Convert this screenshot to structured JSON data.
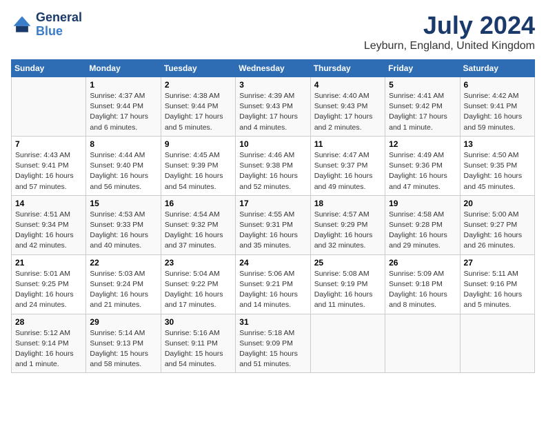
{
  "header": {
    "logo_text_general": "General",
    "logo_text_blue": "Blue",
    "month_title": "July 2024",
    "location": "Leyburn, England, United Kingdom"
  },
  "table": {
    "headers": [
      "Sunday",
      "Monday",
      "Tuesday",
      "Wednesday",
      "Thursday",
      "Friday",
      "Saturday"
    ],
    "rows": [
      [
        {
          "day": "",
          "sunrise": "",
          "sunset": "",
          "daylight": ""
        },
        {
          "day": "1",
          "sunrise": "Sunrise: 4:37 AM",
          "sunset": "Sunset: 9:44 PM",
          "daylight": "Daylight: 17 hours and 6 minutes."
        },
        {
          "day": "2",
          "sunrise": "Sunrise: 4:38 AM",
          "sunset": "Sunset: 9:44 PM",
          "daylight": "Daylight: 17 hours and 5 minutes."
        },
        {
          "day": "3",
          "sunrise": "Sunrise: 4:39 AM",
          "sunset": "Sunset: 9:43 PM",
          "daylight": "Daylight: 17 hours and 4 minutes."
        },
        {
          "day": "4",
          "sunrise": "Sunrise: 4:40 AM",
          "sunset": "Sunset: 9:43 PM",
          "daylight": "Daylight: 17 hours and 2 minutes."
        },
        {
          "day": "5",
          "sunrise": "Sunrise: 4:41 AM",
          "sunset": "Sunset: 9:42 PM",
          "daylight": "Daylight: 17 hours and 1 minute."
        },
        {
          "day": "6",
          "sunrise": "Sunrise: 4:42 AM",
          "sunset": "Sunset: 9:41 PM",
          "daylight": "Daylight: 16 hours and 59 minutes."
        }
      ],
      [
        {
          "day": "7",
          "sunrise": "Sunrise: 4:43 AM",
          "sunset": "Sunset: 9:41 PM",
          "daylight": "Daylight: 16 hours and 57 minutes."
        },
        {
          "day": "8",
          "sunrise": "Sunrise: 4:44 AM",
          "sunset": "Sunset: 9:40 PM",
          "daylight": "Daylight: 16 hours and 56 minutes."
        },
        {
          "day": "9",
          "sunrise": "Sunrise: 4:45 AM",
          "sunset": "Sunset: 9:39 PM",
          "daylight": "Daylight: 16 hours and 54 minutes."
        },
        {
          "day": "10",
          "sunrise": "Sunrise: 4:46 AM",
          "sunset": "Sunset: 9:38 PM",
          "daylight": "Daylight: 16 hours and 52 minutes."
        },
        {
          "day": "11",
          "sunrise": "Sunrise: 4:47 AM",
          "sunset": "Sunset: 9:37 PM",
          "daylight": "Daylight: 16 hours and 49 minutes."
        },
        {
          "day": "12",
          "sunrise": "Sunrise: 4:49 AM",
          "sunset": "Sunset: 9:36 PM",
          "daylight": "Daylight: 16 hours and 47 minutes."
        },
        {
          "day": "13",
          "sunrise": "Sunrise: 4:50 AM",
          "sunset": "Sunset: 9:35 PM",
          "daylight": "Daylight: 16 hours and 45 minutes."
        }
      ],
      [
        {
          "day": "14",
          "sunrise": "Sunrise: 4:51 AM",
          "sunset": "Sunset: 9:34 PM",
          "daylight": "Daylight: 16 hours and 42 minutes."
        },
        {
          "day": "15",
          "sunrise": "Sunrise: 4:53 AM",
          "sunset": "Sunset: 9:33 PM",
          "daylight": "Daylight: 16 hours and 40 minutes."
        },
        {
          "day": "16",
          "sunrise": "Sunrise: 4:54 AM",
          "sunset": "Sunset: 9:32 PM",
          "daylight": "Daylight: 16 hours and 37 minutes."
        },
        {
          "day": "17",
          "sunrise": "Sunrise: 4:55 AM",
          "sunset": "Sunset: 9:31 PM",
          "daylight": "Daylight: 16 hours and 35 minutes."
        },
        {
          "day": "18",
          "sunrise": "Sunrise: 4:57 AM",
          "sunset": "Sunset: 9:29 PM",
          "daylight": "Daylight: 16 hours and 32 minutes."
        },
        {
          "day": "19",
          "sunrise": "Sunrise: 4:58 AM",
          "sunset": "Sunset: 9:28 PM",
          "daylight": "Daylight: 16 hours and 29 minutes."
        },
        {
          "day": "20",
          "sunrise": "Sunrise: 5:00 AM",
          "sunset": "Sunset: 9:27 PM",
          "daylight": "Daylight: 16 hours and 26 minutes."
        }
      ],
      [
        {
          "day": "21",
          "sunrise": "Sunrise: 5:01 AM",
          "sunset": "Sunset: 9:25 PM",
          "daylight": "Daylight: 16 hours and 24 minutes."
        },
        {
          "day": "22",
          "sunrise": "Sunrise: 5:03 AM",
          "sunset": "Sunset: 9:24 PM",
          "daylight": "Daylight: 16 hours and 21 minutes."
        },
        {
          "day": "23",
          "sunrise": "Sunrise: 5:04 AM",
          "sunset": "Sunset: 9:22 PM",
          "daylight": "Daylight: 16 hours and 17 minutes."
        },
        {
          "day": "24",
          "sunrise": "Sunrise: 5:06 AM",
          "sunset": "Sunset: 9:21 PM",
          "daylight": "Daylight: 16 hours and 14 minutes."
        },
        {
          "day": "25",
          "sunrise": "Sunrise: 5:08 AM",
          "sunset": "Sunset: 9:19 PM",
          "daylight": "Daylight: 16 hours and 11 minutes."
        },
        {
          "day": "26",
          "sunrise": "Sunrise: 5:09 AM",
          "sunset": "Sunset: 9:18 PM",
          "daylight": "Daylight: 16 hours and 8 minutes."
        },
        {
          "day": "27",
          "sunrise": "Sunrise: 5:11 AM",
          "sunset": "Sunset: 9:16 PM",
          "daylight": "Daylight: 16 hours and 5 minutes."
        }
      ],
      [
        {
          "day": "28",
          "sunrise": "Sunrise: 5:12 AM",
          "sunset": "Sunset: 9:14 PM",
          "daylight": "Daylight: 16 hours and 1 minute."
        },
        {
          "day": "29",
          "sunrise": "Sunrise: 5:14 AM",
          "sunset": "Sunset: 9:13 PM",
          "daylight": "Daylight: 15 hours and 58 minutes."
        },
        {
          "day": "30",
          "sunrise": "Sunrise: 5:16 AM",
          "sunset": "Sunset: 9:11 PM",
          "daylight": "Daylight: 15 hours and 54 minutes."
        },
        {
          "day": "31",
          "sunrise": "Sunrise: 5:18 AM",
          "sunset": "Sunset: 9:09 PM",
          "daylight": "Daylight: 15 hours and 51 minutes."
        },
        {
          "day": "",
          "sunrise": "",
          "sunset": "",
          "daylight": ""
        },
        {
          "day": "",
          "sunrise": "",
          "sunset": "",
          "daylight": ""
        },
        {
          "day": "",
          "sunrise": "",
          "sunset": "",
          "daylight": ""
        }
      ]
    ]
  }
}
